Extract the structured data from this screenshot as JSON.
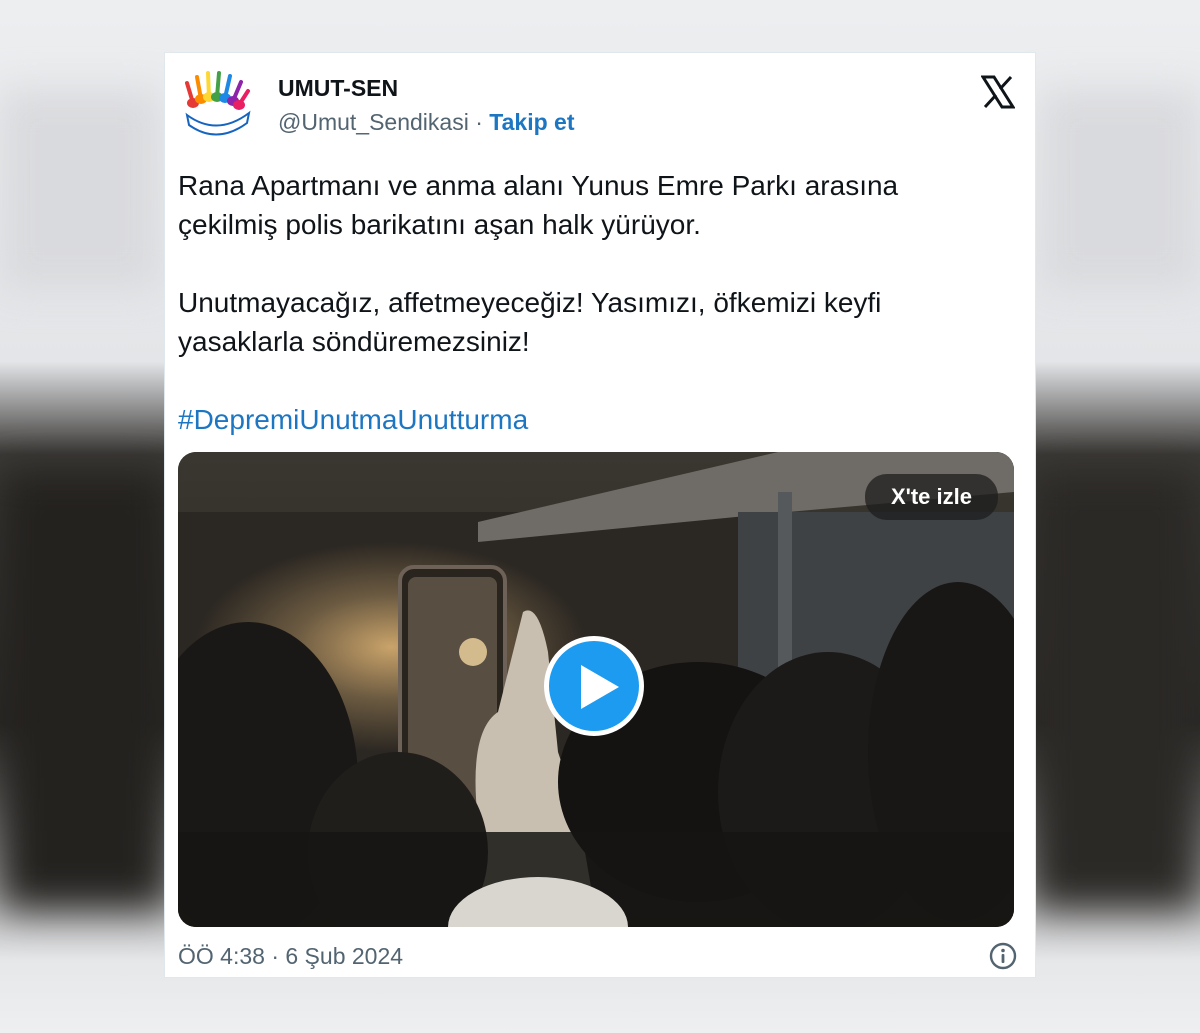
{
  "account": {
    "display_name": "UMUT-SEN",
    "handle": "@Umut_Sendikasi",
    "separator": "·",
    "follow_label": "Takip et",
    "avatar_icon": "umut-sen-logo-icon"
  },
  "tweet": {
    "paragraph_1": "Rana Apartmanı ve anma alanı Yunus Emre Parkı arasına",
    "paragraph_1b": "çekilmiş polis barikatını aşan halk yürüyor.",
    "paragraph_2": "Unutmayacağız, affetmeyeceğiz! Yasımızı, öfkemizi keyfi",
    "paragraph_2b": "yasaklarla söndüremezsiniz!",
    "hashtag": "#DepremiUnutmaUnutturma"
  },
  "media": {
    "watch_label": "X'te izle",
    "play_icon": "play-icon"
  },
  "footer": {
    "timestamp": "ÖÖ 4:38 · 6 Şub 2024",
    "info_icon": "info-icon"
  },
  "colors": {
    "accent": "#1d76c2",
    "play_button": "#1d9bf0",
    "text": "#0f1419",
    "muted": "#536471"
  }
}
